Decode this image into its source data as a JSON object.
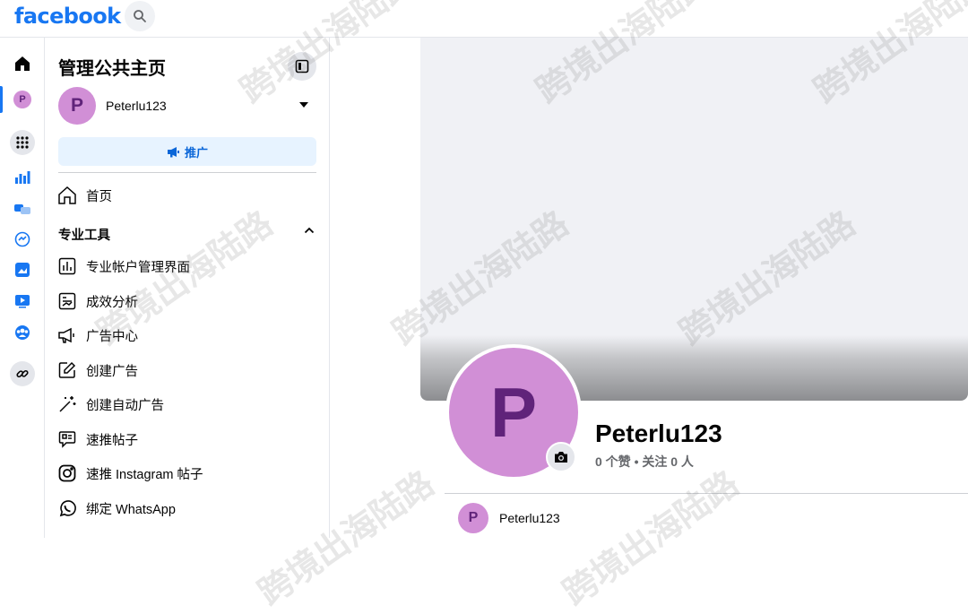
{
  "topbar": {
    "logo": "facebook"
  },
  "panel": {
    "title": "管理公共主页",
    "account_name": "Peterlu123",
    "account_initial": "P",
    "promote_label": "推广",
    "home_label": "首页",
    "section_title": "专业工具",
    "tools": [
      {
        "label": "专业帐户管理界面",
        "icon": "dashboard-icon"
      },
      {
        "label": "成效分析",
        "icon": "insights-icon"
      },
      {
        "label": "广告中心",
        "icon": "megaphone-icon"
      },
      {
        "label": "创建广告",
        "icon": "pencil-icon"
      },
      {
        "label": "创建自动广告",
        "icon": "magic-wand-icon"
      },
      {
        "label": "速推帖子",
        "icon": "boost-post-icon"
      },
      {
        "label": "速推 Instagram 帖子",
        "icon": "instagram-icon"
      },
      {
        "label": "绑定 WhatsApp",
        "icon": "whatsapp-icon"
      }
    ]
  },
  "profile": {
    "initial": "P",
    "name": "Peterlu123",
    "stats": "0 个赞 • 关注 0 人",
    "switch_name": "Peterlu123"
  },
  "watermark": "跨境出海陆路",
  "colors": {
    "brand": "#1877f2",
    "avatar": "#d18fd6",
    "avatar_text": "#60237a"
  }
}
